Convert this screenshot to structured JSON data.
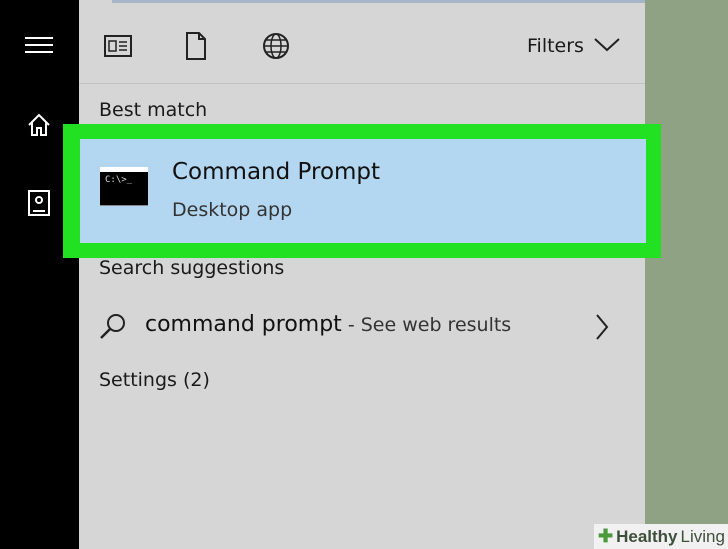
{
  "toolbar": {
    "filters_label": "Filters"
  },
  "sections": {
    "best_match": "Best match",
    "search_suggestions": "Search suggestions",
    "settings": "Settings (2)"
  },
  "best_match_result": {
    "title": "Command Prompt",
    "subtitle": "Desktop app",
    "icon_text": "C:\\>_"
  },
  "suggestion": {
    "query": "command prompt",
    "web_text": " - See web results"
  },
  "watermark": {
    "brand_bold": "Healthy",
    "brand_light": "Living"
  },
  "colors": {
    "highlight": "#22e022",
    "selected_bg": "#b3d6f1",
    "panel_bg": "#d6d6d6",
    "rail_bg": "#000000"
  }
}
